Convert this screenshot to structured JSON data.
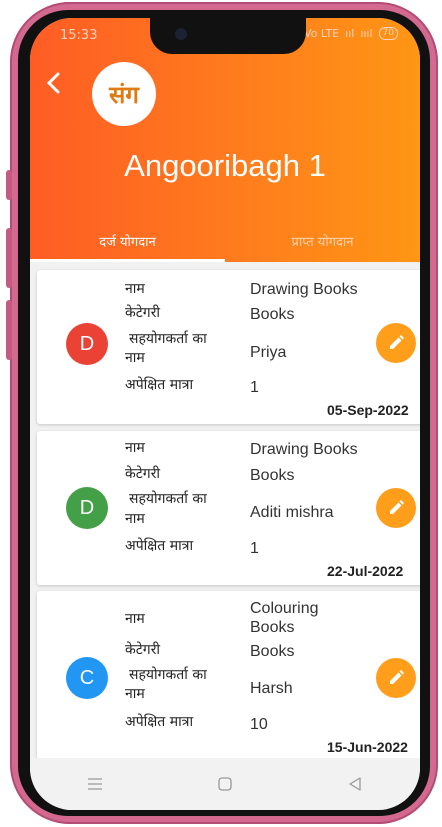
{
  "status": {
    "time": "15:33",
    "network": "Vo LTE",
    "signal1": "ııl",
    "signal2": "ıııl",
    "battery": "70"
  },
  "header": {
    "title": "Angooribagh 1",
    "logo_text": "संग"
  },
  "tabs": [
    {
      "label": "दर्ज योगदान",
      "active": true
    },
    {
      "label": "प्राप्त योगदान",
      "active": false
    }
  ],
  "labels": {
    "name": "नाम",
    "category": "केटेगरी",
    "contributor_line1": "सहयोगकर्ता का",
    "contributor_line2": "नाम",
    "expected_qty": "अपेक्षित मात्रा"
  },
  "items": [
    {
      "avatar_letter": "D",
      "avatar_color": "#ea4335",
      "name": "Drawing Books",
      "category": "Books",
      "contributor": "Priya",
      "quantity": "1",
      "date": "05-Sep-2022"
    },
    {
      "avatar_letter": "D",
      "avatar_color": "#43a047",
      "name": "Drawing Books",
      "category": "Books",
      "contributor": "Aditi mishra",
      "quantity": "1",
      "date": "22-Jul-2022"
    },
    {
      "avatar_letter": "C",
      "avatar_color": "#2196f3",
      "name_line1": "Colouring",
      "name_line2": "Books",
      "category": "Books",
      "contributor": "Harsh",
      "quantity": "10",
      "date": "15-Jun-2022"
    }
  ],
  "colors": {
    "header_start": "#ff5c24",
    "header_end": "#ff9614",
    "edit_button": "#ff9e1b"
  },
  "icons": {
    "back": "arrow-left",
    "edit": "pencil",
    "nav": [
      "menu",
      "home-square",
      "back-triangle"
    ]
  }
}
